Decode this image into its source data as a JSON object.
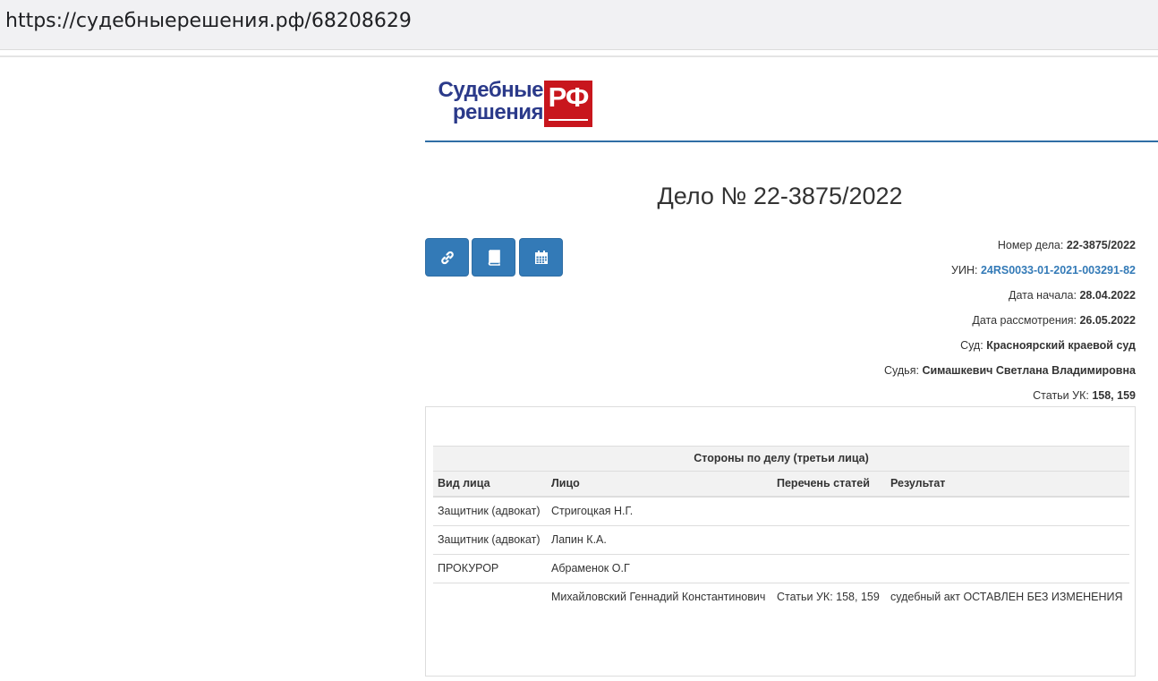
{
  "browser": {
    "url": "https://судебныерешения.рф/68208629"
  },
  "logo": {
    "line1": "Судебные",
    "line2": "решения",
    "badge": "РФ",
    "colors": {
      "text": "#2b3a8a",
      "badge": "#c8161d"
    }
  },
  "case": {
    "title": "Дело № 22-3875/2022"
  },
  "toolbar": {
    "buttons": [
      {
        "icon": "link-icon"
      },
      {
        "icon": "book-icon"
      },
      {
        "icon": "calendar-icon"
      }
    ],
    "color": "#337ab7"
  },
  "details": {
    "case_number_label": "Номер дела:",
    "case_number": "22-3875/2022",
    "uin_label": "УИН:",
    "uin": "24RS0033-01-2021-003291-82",
    "start_date_label": "Дата начала:",
    "start_date": "28.04.2022",
    "review_date_label": "Дата рассмотрения:",
    "review_date": "26.05.2022",
    "court_label": "Суд:",
    "court": "Красноярский краевой суд",
    "judge_label": "Судья:",
    "judge": "Симашкевич Светлана Владимировна",
    "articles_label": "Статьи УК:",
    "articles": "158, 159"
  },
  "parties": {
    "caption": "Стороны по делу (третьи лица)",
    "columns": [
      "Вид лица",
      "Лицо",
      "Перечень статей",
      "Результат"
    ],
    "rows": [
      {
        "type": "Защитник (адвокат)",
        "person": "Стригоцкая Н.Г.",
        "articles": "",
        "result": ""
      },
      {
        "type": "Защитник (адвокат)",
        "person": "Лапин К.А.",
        "articles": "",
        "result": ""
      },
      {
        "type": "ПРОКУРОР",
        "person": "Абраменок О.Г",
        "articles": "",
        "result": ""
      },
      {
        "type": "",
        "person": "Михайловский Геннадий Константинович",
        "articles": "Статьи УК: 158, 159",
        "result": "судебный акт ОСТАВЛЕН БЕЗ ИЗМЕНЕНИЯ"
      }
    ]
  }
}
